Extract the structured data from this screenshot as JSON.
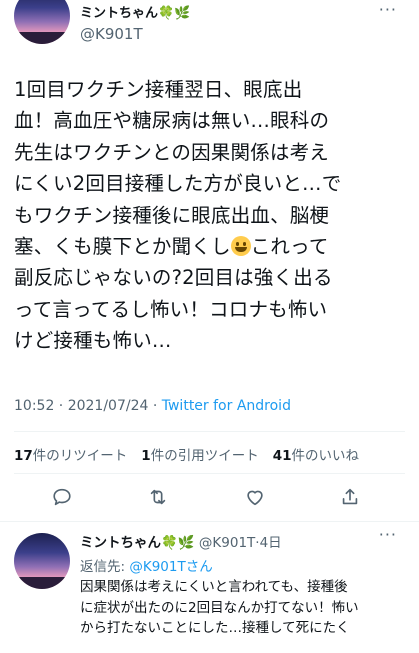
{
  "tweet": {
    "display_name": "ミントちゃん🍀🌿",
    "handle": "@K901T",
    "more": "···",
    "text_lines": [
      "1回目ワクチン接種翌日、眼底出",
      "血！高血圧や糖尿病は無い…眼科の",
      "先生はワクチンとの因果関係は考え",
      "にくい2回目接種した方が良いと…で",
      "もワクチン接種後に眼底出血、脳梗",
      "塞、くも膜下とか聞くし",
      "これって",
      "副反応じゃないの?2回目は強く出る",
      "って言ってるし怖い！コロナも怖い",
      "けど接種も怖い…"
    ],
    "timestamp": "10:52 · 2021/07/24 · ",
    "source": "Twitter for Android"
  },
  "stats": {
    "retweets_count": "17",
    "retweets_label": "件のリツイート",
    "quotes_count": "1",
    "quotes_label": "件の引用ツイート",
    "likes_count": "41",
    "likes_label": "件のいいね"
  },
  "actions": {
    "icons": [
      "reply-icon",
      "retweet-icon",
      "like-icon",
      "share-icon"
    ]
  },
  "reply": {
    "display_name": "ミントちゃん🍀🌿",
    "handle_time": "@K901T·4日",
    "more": "···",
    "replying_to_label": "返信先: ",
    "replying_to_handle": "@K901Tさん",
    "text_lines": [
      "因果関係は考えにくいと言われても、接種後",
      "に症状が出たのに2回目なんか打てない！怖い",
      "から打たないことにした…接種して死にたく"
    ]
  },
  "colors": {
    "text": "#0f1419",
    "secondary": "#536471",
    "link": "#1d9bf0",
    "divider": "#eff3f4"
  }
}
